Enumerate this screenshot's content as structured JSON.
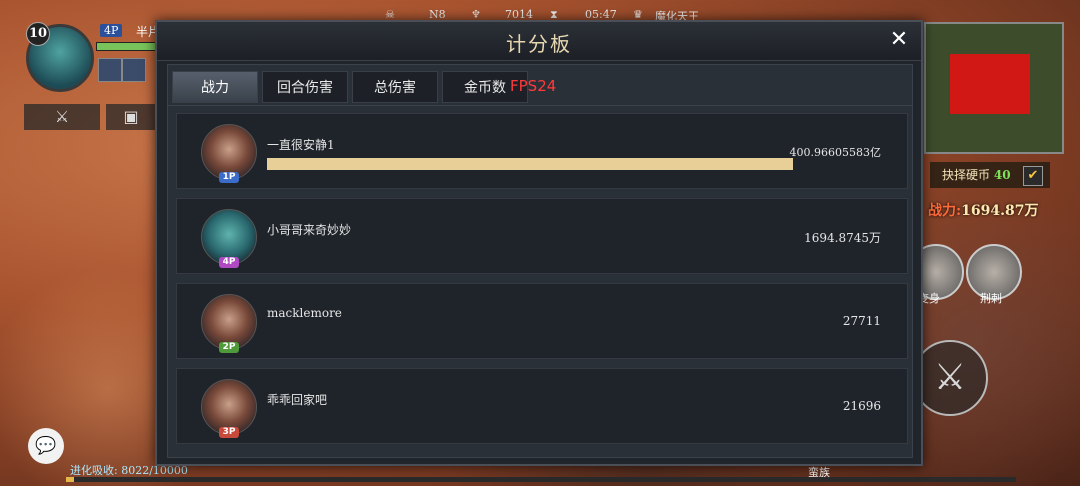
{
  "hud": {
    "player_level": "10",
    "player_tag": "4P",
    "player_name": "半片",
    "topbar_items": [
      "N8",
      "7014",
      "05:47",
      "魔化天王"
    ],
    "evolve_label": "进化吸收: 8022/10000",
    "evolve_progress": 0.008,
    "coin_select_label": "抉择硬币",
    "coin_select_value": "40",
    "power_label": "战力:",
    "power_value": "1694.87万",
    "skill_labels": [
      "变身",
      "荆刺"
    ],
    "bottom_label": "蛮族"
  },
  "scoreboard": {
    "title": "计分板",
    "fps": "FPS24",
    "tabs": [
      "战力",
      "回合伤害",
      "总伤害",
      "金币数"
    ],
    "active_tab": 0,
    "rows": [
      {
        "name": "一直很安静1",
        "badge": "1P",
        "badge_color": "#3a6cc8",
        "score": "400.96605583亿",
        "bar_fill": 1.0
      },
      {
        "name": "小哥哥来奇妙妙",
        "badge": "4P",
        "badge_color": "#b04ac2",
        "score": "1694.8745万"
      },
      {
        "name": "macklemore",
        "badge": "2P",
        "badge_color": "#4f9a3a",
        "score": "27711"
      },
      {
        "name": "乖乖回家吧",
        "badge": "3P",
        "badge_color": "#c84a3a",
        "score": "21696"
      }
    ]
  }
}
